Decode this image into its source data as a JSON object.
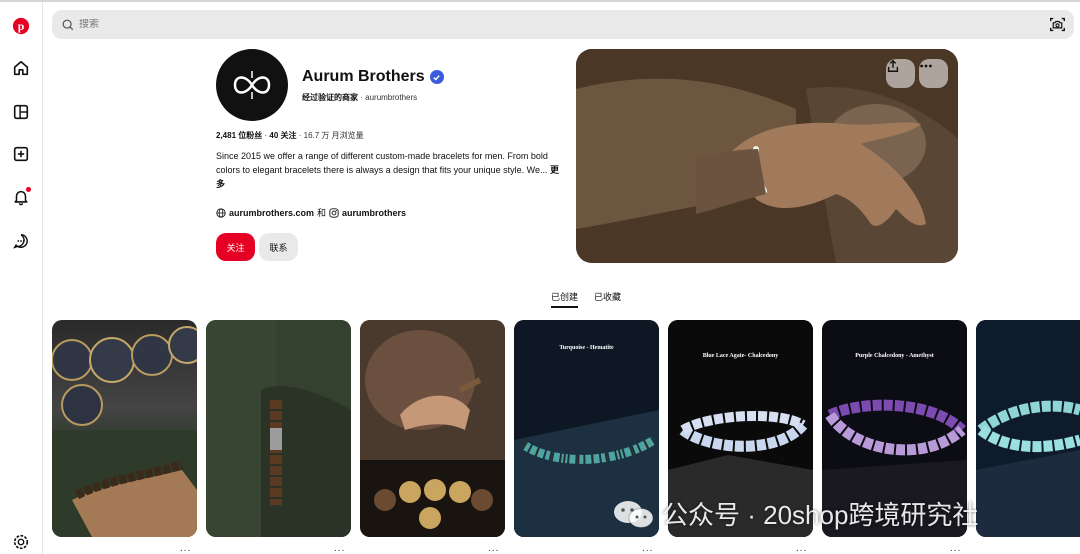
{
  "search": {
    "placeholder": "搜索"
  },
  "profile": {
    "name": "Aurum Brothers",
    "merchant_label": "经过验证的商家",
    "handle": "aurumbrothers",
    "followers": "2,481 位粉丝",
    "following": "40 关注",
    "monthly_views": "16.7 万 月浏览量",
    "description": "Since 2015 we offer a range of different custom-made bracelets for men. From bold colors to elegant bracelets there is always a design that fits your unique style. We...",
    "more_label": "更多",
    "website": "aurumbrothers.com",
    "and_label": "和",
    "instagram": "aurumbrothers",
    "follow_label": "关注",
    "contact_label": "联系"
  },
  "tabs": [
    {
      "label": "已创建",
      "active": true
    },
    {
      "label": "已收藏",
      "active": false
    }
  ],
  "pins": [
    {
      "caption": ""
    },
    {
      "caption": ""
    },
    {
      "caption": ""
    },
    {
      "caption": "Turquoise - Hematite"
    },
    {
      "caption": "Blue Lace Agate- Chalcedony"
    },
    {
      "caption": "Purple Chalcedony - Amethyst"
    },
    {
      "caption": ""
    }
  ],
  "pin_more_label": "...",
  "watermark": {
    "text": "公众号 · 20shop跨境研究社"
  },
  "colors": {
    "brand_red": "#e60023",
    "verified_blue": "#3b5bdb",
    "search_bg": "#e9e9e9"
  },
  "icons": [
    "pinterest-logo-icon",
    "home-icon",
    "layout-icon",
    "create-icon",
    "bell-icon",
    "message-icon",
    "settings-icon",
    "search-icon",
    "camera-search-icon",
    "share-icon",
    "more-icon",
    "globe-icon",
    "instagram-icon",
    "verified-icon"
  ]
}
